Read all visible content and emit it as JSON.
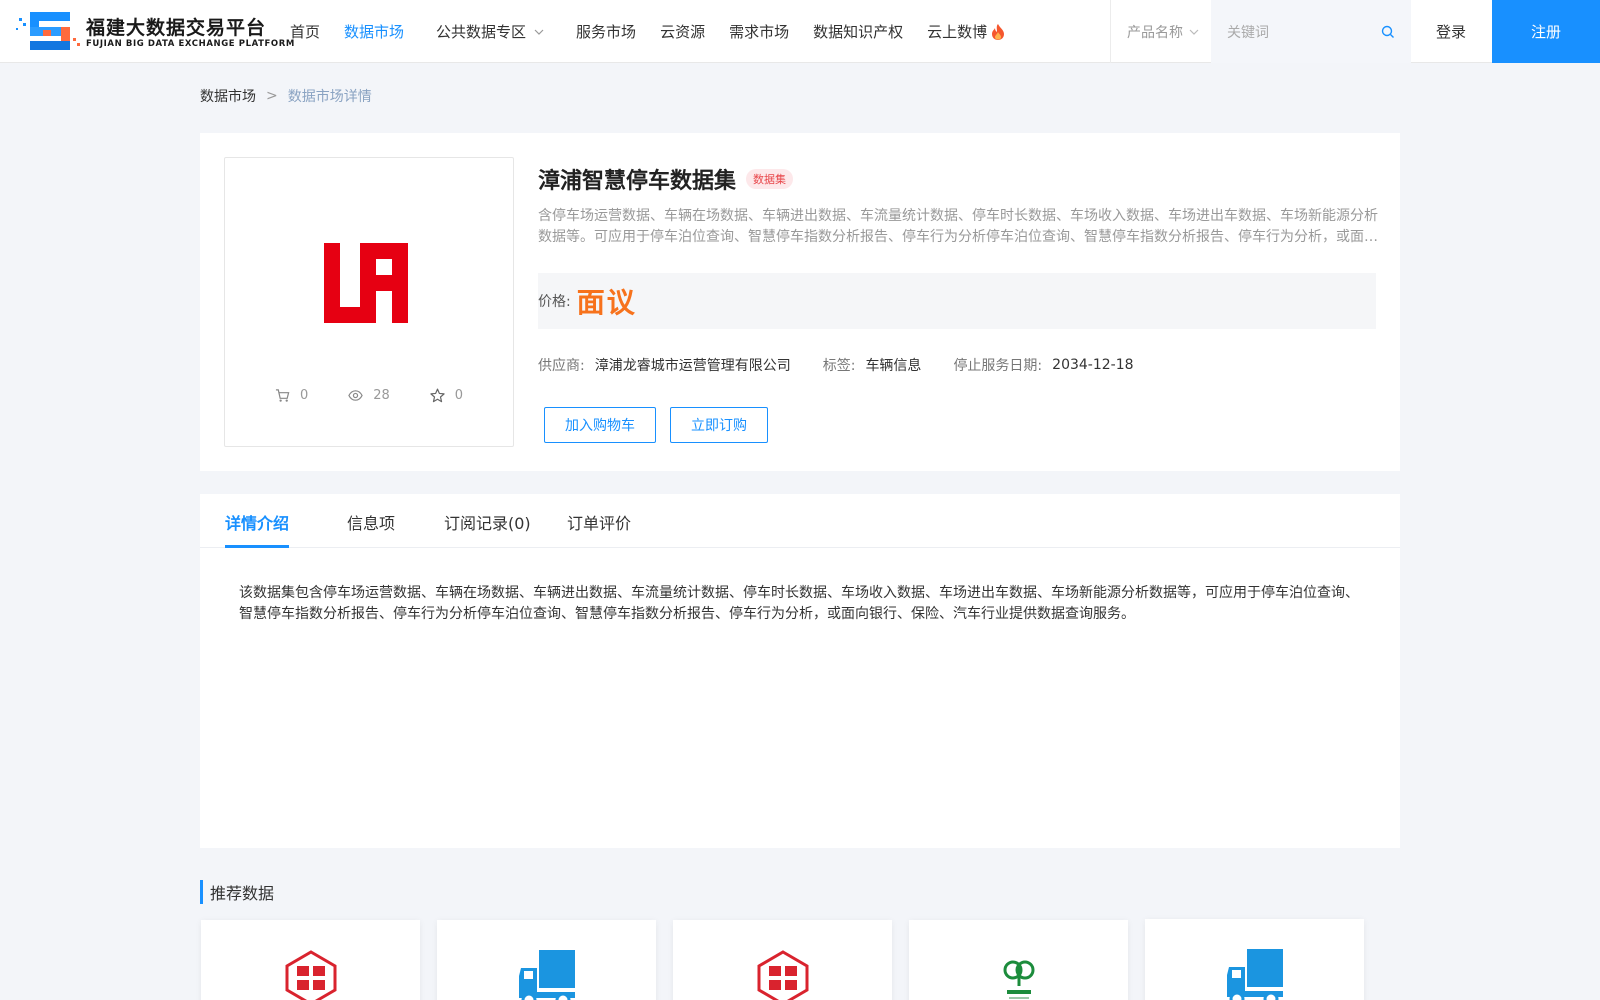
{
  "header": {
    "logo_cn": "福建大数据交易平台",
    "logo_en": "FUJIAN BIG DATA EXCHANGE  PLATFORM",
    "nav": [
      {
        "label": "首页",
        "active": false
      },
      {
        "label": "数据市场",
        "active": true
      },
      {
        "label": "公共数据专区",
        "active": false,
        "dropdown": true
      },
      {
        "label": "服务市场",
        "active": false
      },
      {
        "label": "云资源",
        "active": false
      },
      {
        "label": "需求市场",
        "active": false
      },
      {
        "label": "数据知识产权",
        "active": false
      },
      {
        "label": "云上数博",
        "active": false,
        "icon": "fire-icon"
      }
    ],
    "search_category": "产品名称",
    "search_placeholder": "关键词",
    "login_label": "登录",
    "register_label": "注册",
    "accent_color": "#1890ff"
  },
  "breadcrumb": {
    "items": [
      "数据市场",
      "数据市场详情"
    ],
    "separator": ">"
  },
  "product": {
    "title": "漳浦智慧停车数据集",
    "badge": "数据集",
    "description": "含停车场运营数据、车辆在场数据、车辆进出数据、车流量统计数据、停车时长数据、车场收入数据、车场进出车数据、车场新能源分析数据等。可应用于停车泊位查询、智慧停车指数分析报告、停车行为分析停车泊位查询、智慧停车指数分析报告、停车行为分析，或面向银行、保险、汽车行业提供数据查询服务。",
    "price_label": "价格:",
    "price_value": "面议",
    "price_color": "#f7721c",
    "supplier_label": "供应商:",
    "supplier_value": "漳浦龙睿城市运营管理有限公司",
    "tag_label": "标签:",
    "tag_value": "车辆信息",
    "stop_label": "停止服务日期:",
    "stop_value": "2034-12-18",
    "stats": {
      "cart_count": "0",
      "view_count": "28",
      "favorite_count": "0"
    },
    "add_cart_label": "加入购物车",
    "order_label": "立即订购"
  },
  "detail": {
    "tabs": [
      "详情介绍",
      "信息项",
      "订阅记录(0)",
      "订单评价"
    ],
    "active_tab": "详情介绍",
    "text": "该数据集包含停车场运营数据、车辆在场数据、车辆进出数据、车流量统计数据、停车时长数据、车场收入数据、车场进出车数据、车场新能源分析数据等，可应用于停车泊位查询、智慧停车指数分析报告、停车行为分析停车泊位查询、智慧停车指数分析报告、停车行为分析，或面向银行、保险、汽车行业提供数据查询服务。"
  },
  "recommend": {
    "title": "推荐数据",
    "cards": [
      {
        "icon": "red-seal-logo-icon"
      },
      {
        "icon": "blue-truck-icon"
      },
      {
        "icon": "red-seal-logo-icon"
      },
      {
        "icon": "green-tree-logo-icon"
      },
      {
        "icon": "blue-truck-icon"
      }
    ]
  }
}
